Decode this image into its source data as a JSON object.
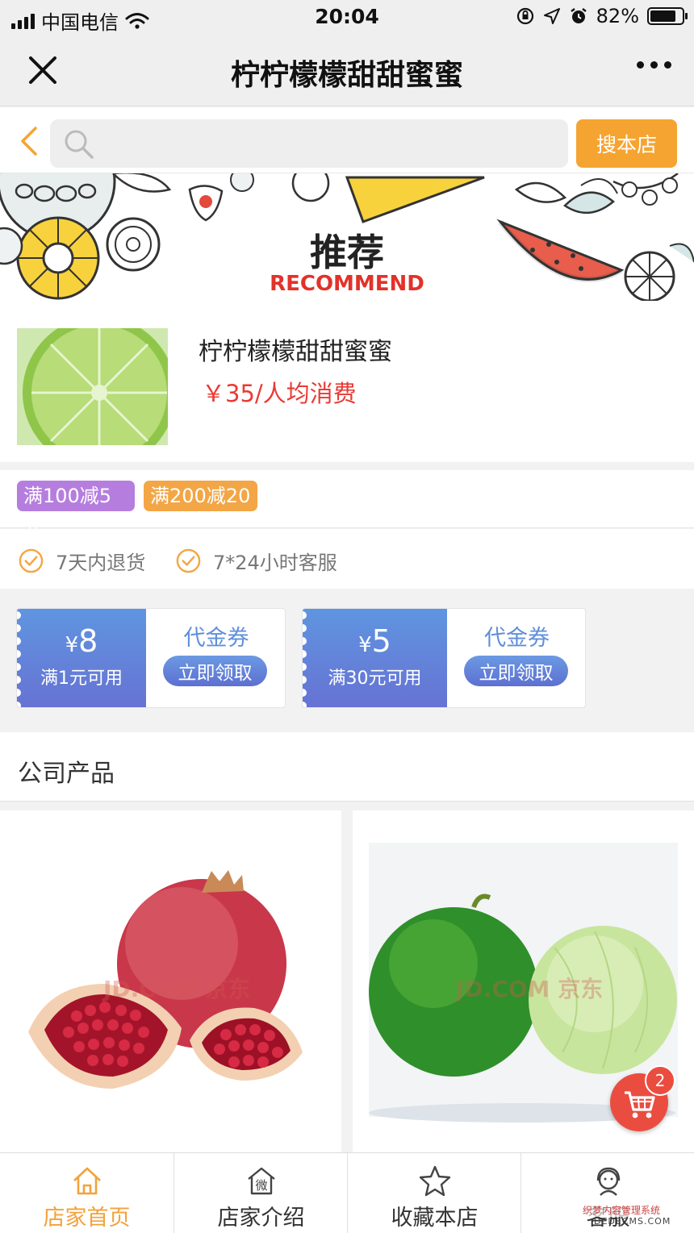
{
  "status_bar": {
    "carrier": "中国电信",
    "time": "20:04",
    "battery": "82%",
    "battery_level": 0.82
  },
  "nav": {
    "title": "柠柠檬檬甜甜蜜蜜",
    "close_icon": "close-icon",
    "more_icon": "more-icon"
  },
  "search": {
    "value": "",
    "button_label": "搜本店"
  },
  "banner": {
    "title": "推荐",
    "subtitle": "RECOMMEND"
  },
  "summary": {
    "name": "柠柠檬檬甜甜蜜蜜",
    "price": "￥35/人均消费"
  },
  "promos": [
    "满100减5元",
    "满200减20"
  ],
  "services": [
    "7天内退货",
    "7*24小时客服"
  ],
  "coupons": [
    {
      "currency": "¥",
      "amount": "8",
      "condition": "满1元可用",
      "title": "代金券",
      "button": "立即领取"
    },
    {
      "currency": "¥",
      "amount": "5",
      "condition": "满30元可用",
      "title": "代金券",
      "button": "立即领取"
    }
  ],
  "section": {
    "title": "公司产品"
  },
  "products": [
    {
      "image": "pomegranate",
      "watermark": "JD.COM 京东"
    },
    {
      "image": "limes",
      "watermark": "JD.COM 京东"
    }
  ],
  "cart": {
    "count": "2"
  },
  "tabs": [
    {
      "label": "店家首页",
      "icon": "home-icon",
      "active": true
    },
    {
      "label": "店家介绍",
      "icon": "shop-icon",
      "active": false
    },
    {
      "label": "收藏本店",
      "icon": "star-icon",
      "active": false
    },
    {
      "label": "客服",
      "icon": "service-icon",
      "active": false
    }
  ],
  "watermark": {
    "line1": "织梦内容管理系统",
    "line2": "DEDECMS.COM"
  },
  "colors": {
    "accent": "#f6a431",
    "price": "#e93b34",
    "coupon": "#6580d8",
    "tag_purple": "#b57ede",
    "tag_orange": "#f3a645",
    "cart": "#ea4d40"
  }
}
